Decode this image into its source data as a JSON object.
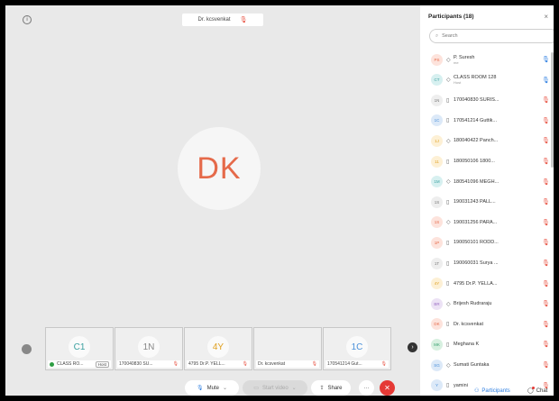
{
  "stage": {
    "info_icon": "i",
    "active_speaker": "Dr. kcsvenkat",
    "big_avatar_initials": "DK",
    "big_avatar_color": "#e56a4a"
  },
  "filmstrip": [
    {
      "initials": "C1",
      "name": "CLASS RO...",
      "badge": "Host",
      "color": "#3aa0a0",
      "muted": false,
      "host": true
    },
    {
      "initials": "1N",
      "name": "170040830 SU...",
      "badge": "",
      "color": "#888888",
      "muted": true
    },
    {
      "initials": "4Y",
      "name": "4795 Dr.P. YELL...",
      "badge": "",
      "color": "#e0a020",
      "muted": true
    },
    {
      "initials": "",
      "name": "Dr. kcsvenkat",
      "badge": "",
      "color": "#888888",
      "muted": true
    },
    {
      "initials": "1C",
      "name": "170541214 Gut...",
      "badge": "",
      "color": "#4a90d9",
      "muted": true
    }
  ],
  "controls": {
    "mute": "Mute",
    "start_video": "Start video",
    "share": "Share",
    "more": "···",
    "end": "✕"
  },
  "panel": {
    "title": "Participants (18)",
    "close": "×",
    "search_placeholder": "Search",
    "participants": [
      {
        "initials": "PS",
        "name": "P. Suresh",
        "sub": "me",
        "mic": "active",
        "device": "computer",
        "bg": "#fde3dc",
        "fg": "#e56a4a"
      },
      {
        "initials": "CT",
        "name": "CLASS ROOM 128",
        "sub": "Host",
        "mic": "active",
        "device": "computer",
        "bg": "#d7f0f0",
        "fg": "#3aa0a0"
      },
      {
        "initials": "1N",
        "name": "170040830 SURIS...",
        "sub": "",
        "mic": "muted",
        "device": "phone",
        "bg": "#eeeeee",
        "fg": "#777777"
      },
      {
        "initials": "1C",
        "name": "170541214 Guttik...",
        "sub": "",
        "mic": "muted",
        "device": "phone",
        "bg": "#dce9f8",
        "fg": "#4a90d9"
      },
      {
        "initials": "1J",
        "name": "180040422 Panch...",
        "sub": "",
        "mic": "muted",
        "device": "computer",
        "bg": "#fdf0d5",
        "fg": "#e0a020"
      },
      {
        "initials": "11",
        "name": "180050106 1800...",
        "sub": "",
        "mic": "muted",
        "device": "phone",
        "bg": "#fdf0d5",
        "fg": "#e0a020"
      },
      {
        "initials": "1M",
        "name": "180541096 MEGH...",
        "sub": "",
        "mic": "muted",
        "device": "computer",
        "bg": "#d7f0f0",
        "fg": "#3aa0a0"
      },
      {
        "initials": "1S",
        "name": "190031243 PALL...",
        "sub": "",
        "mic": "muted",
        "device": "phone",
        "bg": "#eeeeee",
        "fg": "#777777"
      },
      {
        "initials": "1S",
        "name": "190031256 PARA...",
        "sub": "",
        "mic": "muted",
        "device": "computer",
        "bg": "#fde3dc",
        "fg": "#e56a4a"
      },
      {
        "initials": "1P",
        "name": "190050101 RODD...",
        "sub": "",
        "mic": "muted",
        "device": "phone",
        "bg": "#fde3dc",
        "fg": "#e56a4a"
      },
      {
        "initials": "1T",
        "name": "190060031 Surya ...",
        "sub": "",
        "mic": "muted",
        "device": "phone",
        "bg": "#eeeeee",
        "fg": "#777777"
      },
      {
        "initials": "4Y",
        "name": "4795 Dr.P. YELLA...",
        "sub": "",
        "mic": "muted",
        "device": "phone",
        "bg": "#fdf0d5",
        "fg": "#e0a020"
      },
      {
        "initials": "BR",
        "name": "Brijesh Rudraraju",
        "sub": "",
        "mic": "muted",
        "device": "computer",
        "bg": "#ece2f5",
        "fg": "#9a6cc4"
      },
      {
        "initials": "DK",
        "name": "Dr. kcsvenkat",
        "sub": "",
        "mic": "muted",
        "device": "phone",
        "bg": "#fde3dc",
        "fg": "#e56a4a"
      },
      {
        "initials": "MK",
        "name": "Meghana K",
        "sub": "",
        "mic": "muted",
        "device": "phone",
        "bg": "#d7f0e0",
        "fg": "#3aa070"
      },
      {
        "initials": "SG",
        "name": "Sumati Guntaka",
        "sub": "",
        "mic": "muted",
        "device": "computer",
        "bg": "#dce9f8",
        "fg": "#4a90d9"
      },
      {
        "initials": "Y",
        "name": "yamini",
        "sub": "",
        "mic": "muted",
        "device": "phone",
        "bg": "#dce9f8",
        "fg": "#4a90d9"
      }
    ],
    "footer_participants": "Participants",
    "footer_chat": "Chat"
  },
  "colors": {
    "accent": "#2a7de1",
    "muted_mic": "#e74c3c",
    "end_call": "#e53935"
  }
}
